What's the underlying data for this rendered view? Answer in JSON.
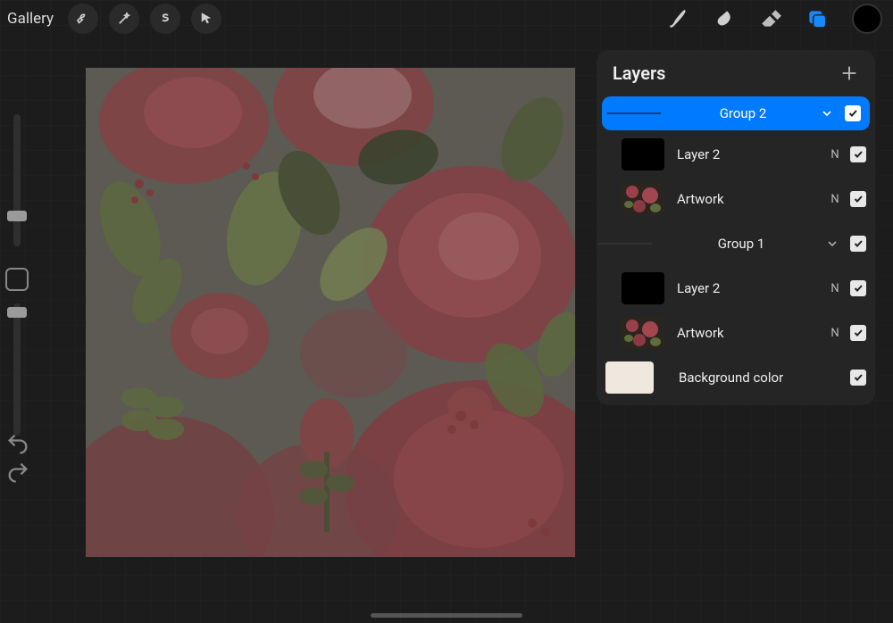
{
  "topbar": {
    "gallery": "Gallery"
  },
  "panel": {
    "title": "Layers",
    "group2": "Group 2",
    "group1": "Group 1",
    "layer2a": "Layer 2",
    "artwork_a": "Artwork",
    "layer2b": "Layer 2",
    "artwork_b": "Artwork",
    "bg": "Background color",
    "blend_n": "N"
  }
}
